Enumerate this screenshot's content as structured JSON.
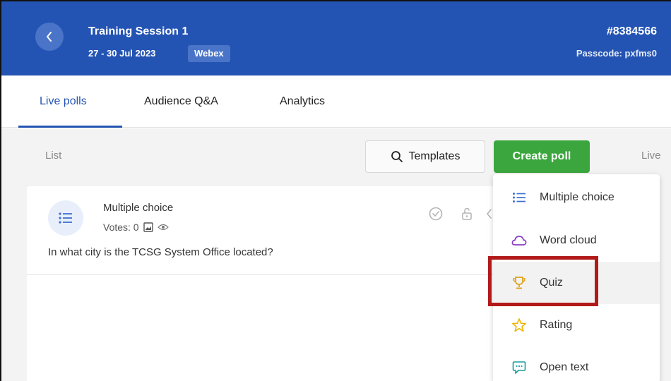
{
  "header": {
    "event_title": "Training Session 1",
    "event_dates": "27 - 30 Jul 2023",
    "platform": "Webex",
    "event_code": "#8384566",
    "passcode": "Passcode: pxfms0",
    "background_color": "#2454b3"
  },
  "tabs": [
    {
      "label": "Live polls",
      "active": true
    },
    {
      "label": "Audience Q&A",
      "active": false
    },
    {
      "label": "Analytics",
      "active": false
    }
  ],
  "toolbar": {
    "list_label": "List",
    "templates_label": "Templates",
    "create_poll_label": "Create poll",
    "live_label": "Live",
    "create_poll_color": "#3aa63d"
  },
  "poll": {
    "type": "Multiple choice",
    "votes": "Votes: 0",
    "question": "In what city is the TCSG System Office located?"
  },
  "menu": {
    "items": [
      {
        "label": "Multiple choice",
        "icon": "list-icon"
      },
      {
        "label": "Word cloud",
        "icon": "cloud-icon"
      },
      {
        "label": "Quiz",
        "icon": "trophy-icon",
        "highlighted": true
      },
      {
        "label": "Rating",
        "icon": "star-icon"
      },
      {
        "label": "Open text",
        "icon": "speech-bubble-icon"
      }
    ]
  }
}
